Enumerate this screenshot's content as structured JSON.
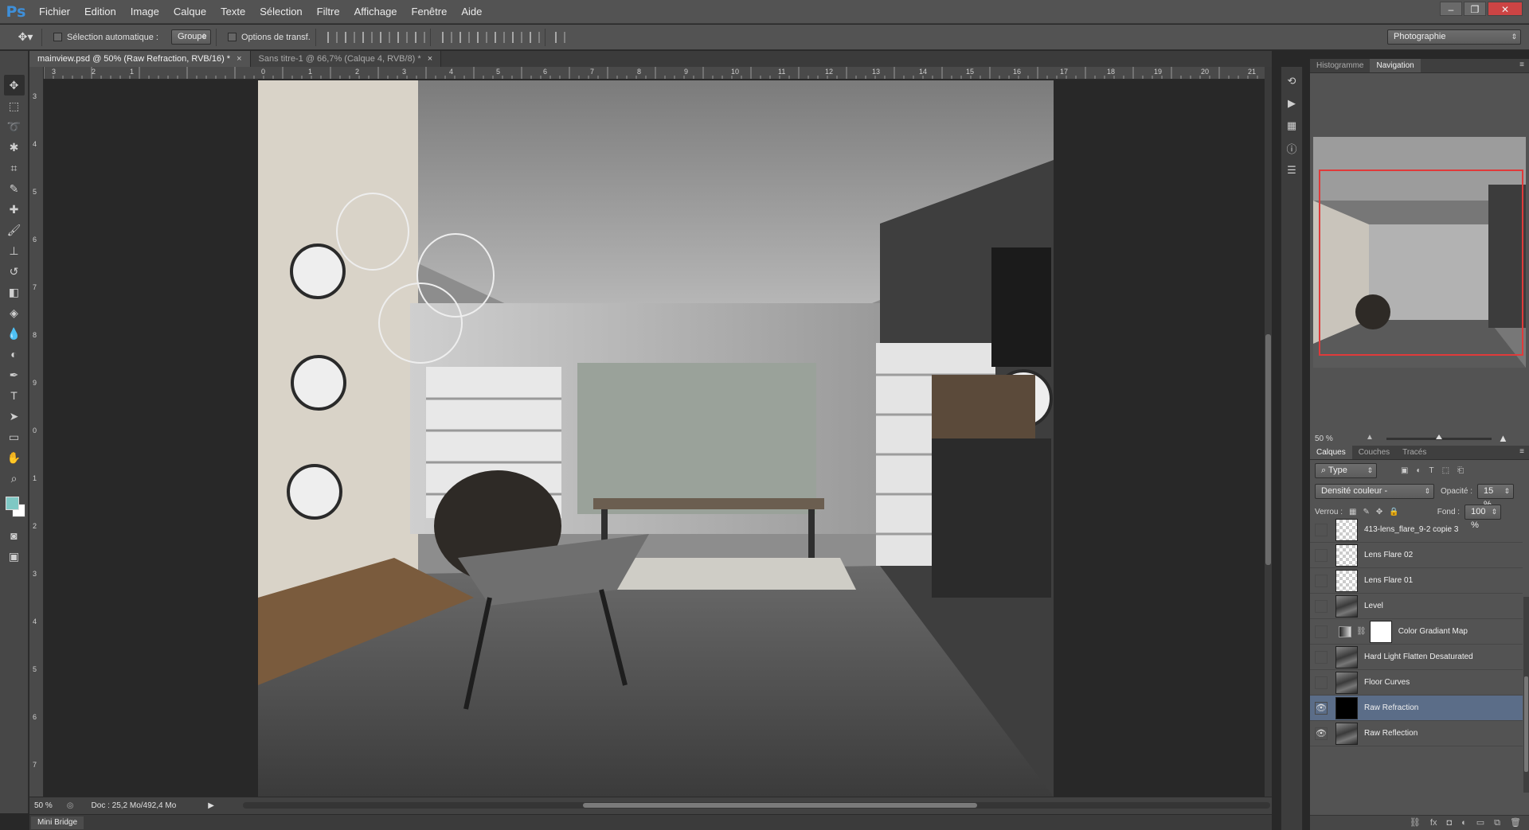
{
  "app": {
    "logo": "Ps"
  },
  "menu": [
    "Fichier",
    "Edition",
    "Image",
    "Calque",
    "Texte",
    "Sélection",
    "Filtre",
    "Affichage",
    "Fenêtre",
    "Aide"
  ],
  "options": {
    "auto_select_label": "Sélection automatique :",
    "auto_select_value": "Groupe",
    "transform_label": "Options de transf.",
    "workspace": "Photographie"
  },
  "tabs": [
    {
      "label": "mainview.psd @ 50% (Raw Refraction, RVB/16) *"
    },
    {
      "label": "Sans titre-1 @ 66,7% (Calque 4, RVB/8) *"
    }
  ],
  "ruler": {
    "top": [
      "0",
      "1",
      "2",
      "3",
      "4",
      "5",
      "6",
      "7",
      "8",
      "9",
      "10",
      "11",
      "12",
      "13",
      "14",
      "15",
      "16",
      "17",
      "18",
      "19",
      "20",
      "21"
    ],
    "top_neg": [
      "3",
      "2",
      "1"
    ],
    "left": [
      "3",
      "4",
      "5",
      "6",
      "7",
      "8",
      "9",
      "0",
      "1",
      "2",
      "3",
      "4",
      "5",
      "6",
      "7"
    ]
  },
  "status": {
    "zoom": "50 %",
    "doc": "Doc : 25,2 Mo/492,4 Mo"
  },
  "minibridge": "Mini Bridge",
  "navigator": {
    "tabs": [
      "Histogramme",
      "Navigation"
    ],
    "zoom": "50 %"
  },
  "layers": {
    "tabs": [
      "Calques",
      "Couches",
      "Tracés"
    ],
    "filter": "Type",
    "blend_mode": "Densité couleur -",
    "opacity_label": "Opacité :",
    "opacity": "15 %",
    "lock_label": "Verrou :",
    "fill_label": "Fond :",
    "fill": "100 %",
    "items": [
      {
        "name": "413-lens_flare_9-2 copie 3",
        "thumb": "checker",
        "visible": false
      },
      {
        "name": "Lens Flare 02",
        "thumb": "checker",
        "visible": false
      },
      {
        "name": "Lens Flare 01",
        "thumb": "checker",
        "visible": false
      },
      {
        "name": "Level",
        "thumb": "photo",
        "visible": false
      },
      {
        "name": "Color Gradiant Map",
        "thumb": "adjust",
        "visible": false
      },
      {
        "name": "Hard Light Flatten Desaturated",
        "thumb": "photo",
        "visible": false
      },
      {
        "name": "Floor Curves",
        "thumb": "photo",
        "visible": false
      },
      {
        "name": "Raw Refraction",
        "thumb": "black",
        "visible": true,
        "selected": true
      },
      {
        "name": "Raw Reflection",
        "thumb": "photo",
        "visible": true
      }
    ]
  },
  "colors": {
    "foreground": "#7fc8c4",
    "background": "#ffffff",
    "selection": "#5b6d88",
    "nav_frame": "#e03a3a"
  }
}
